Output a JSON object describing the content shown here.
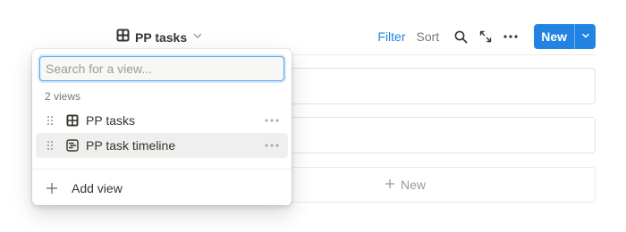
{
  "header": {
    "view_title": "PP tasks",
    "view_icon": "table-icon",
    "dropdown_icon": "chevron-down-icon"
  },
  "toolbar": {
    "filter_label": "Filter",
    "sort_label": "Sort",
    "icons": [
      "search-icon",
      "expand-icon",
      "more-icon"
    ],
    "new_label": "New",
    "accent_color": "#2383e2"
  },
  "board": {
    "new_row_label": "New"
  },
  "view_menu": {
    "search_placeholder": "Search for a view...",
    "search_value": "",
    "count_label": "2 views",
    "views": [
      {
        "label": "PP tasks",
        "icon": "table-icon",
        "highlighted": false
      },
      {
        "label": "PP task timeline",
        "icon": "timeline-icon",
        "highlighted": true
      }
    ],
    "add_view_label": "Add view"
  }
}
